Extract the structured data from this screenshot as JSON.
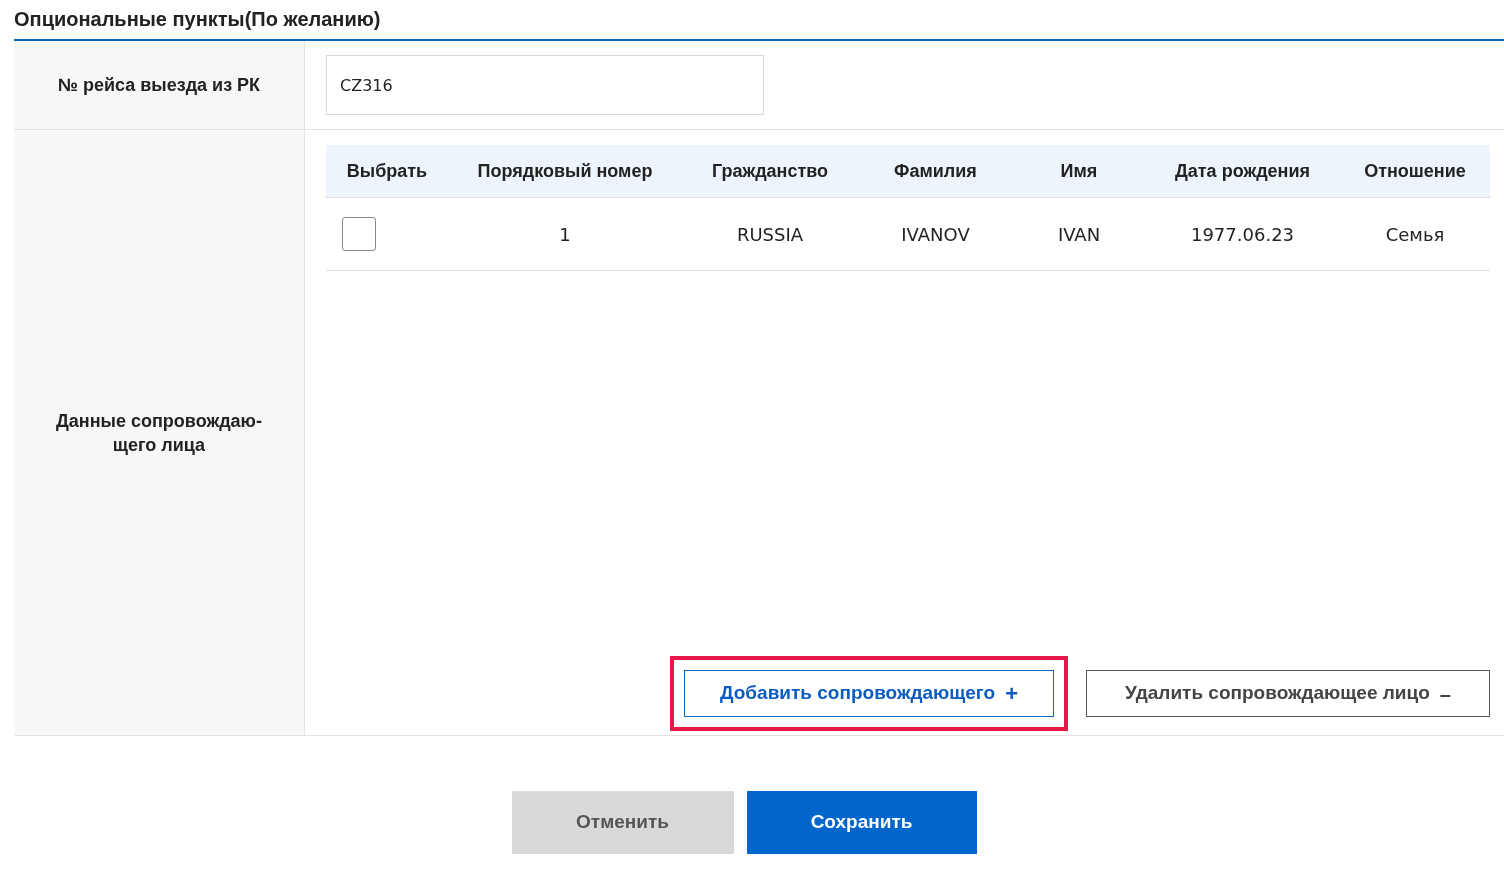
{
  "section_title": "Опциональные пункты(По желанию)",
  "flight": {
    "label": "№ рейса выезда из РК",
    "value": "CZ316"
  },
  "companions": {
    "label": "Данные сопровождаю-\nщего лица",
    "columns": [
      "Выбрать",
      "Порядковый номер",
      "Гражданство",
      "Фамилия",
      "Имя",
      "Дата рождения",
      "Отношение"
    ],
    "rows": [
      {
        "cells": [
          {
            "kind": "checkbox",
            "checked": false
          },
          {
            "kind": "text",
            "text": "1"
          },
          {
            "kind": "text",
            "text": "RUSSIA"
          },
          {
            "kind": "text",
            "text": "IVANOV"
          },
          {
            "kind": "text",
            "text": "IVAN"
          },
          {
            "kind": "text",
            "text": "1977.06.23"
          },
          {
            "kind": "text",
            "text": "Семья"
          }
        ]
      }
    ],
    "add_button": {
      "label": "Добавить сопровождающего",
      "icon": "+",
      "highlighted": true
    },
    "delete_button": {
      "label": "Удалить сопровождающее лицо",
      "icon": "–"
    }
  },
  "actions": {
    "cancel": "Отменить",
    "save": "Сохранить"
  }
}
